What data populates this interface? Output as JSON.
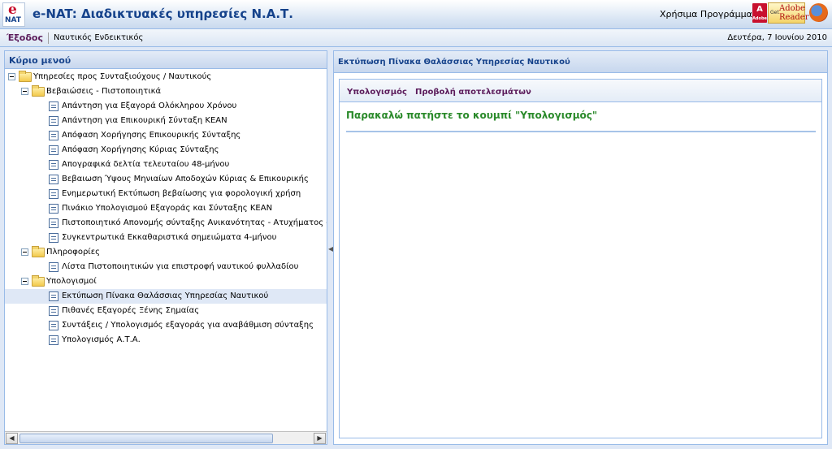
{
  "header": {
    "logo_e": "e",
    "logo_nat": "NAT",
    "title": "e-NAT: Διαδικτυακές υπηρεσίες Ν.Α.Τ.",
    "programs_label": "Χρήσιμα Προγράμματα:",
    "adobe_text": "A",
    "adobe_sub": "Adobe",
    "reader_get": "Get",
    "reader_adobe": "Adobe",
    "reader_reader": "Reader"
  },
  "toolbar": {
    "exit_label": "Έξοδος",
    "user_label": "Ναυτικός Ενδεικτικός",
    "date": "Δευτέρα, 7 Ιουνίου 2010"
  },
  "left_panel": {
    "title": "Κύριο μενού",
    "tree": [
      {
        "label": "Υπηρεσίες προς Συνταξιούχους / Ναυτικούς",
        "type": "folder",
        "level": 0
      },
      {
        "label": "Βεβαιώσεις - Πιστοποιητικά",
        "type": "folder",
        "level": 1
      },
      {
        "label": "Απάντηση για Εξαγορά Ολόκληρου Χρόνου",
        "type": "leaf",
        "level": 2
      },
      {
        "label": "Απάντηση για Επικουρική Σύνταξη ΚΕΑΝ",
        "type": "leaf",
        "level": 2
      },
      {
        "label": "Απόφαση Χορήγησης Επικουρικής Σύνταξης",
        "type": "leaf",
        "level": 2
      },
      {
        "label": "Απόφαση Χορήγησης Κύριας Σύνταξης",
        "type": "leaf",
        "level": 2
      },
      {
        "label": "Απογραφικά δελτία τελευταίου 48-μήνου",
        "type": "leaf",
        "level": 2
      },
      {
        "label": "Βεβαιωση Ύψους Μηνιαίων Αποδοχών Κύριας & Επικουρικής",
        "type": "leaf",
        "level": 2
      },
      {
        "label": "Ενημερωτική Εκτύπωση βεβαίωσης για φορολογική χρήση",
        "type": "leaf",
        "level": 2
      },
      {
        "label": "Πινάκιο Υπολογισμού Εξαγοράς και Σύνταξης ΚΕΑΝ",
        "type": "leaf",
        "level": 2
      },
      {
        "label": "Πιστοποιητικό Απονομής σύνταξης Ανικανότητας - Ατυχήματος - Γήρ",
        "type": "leaf",
        "level": 2
      },
      {
        "label": "Συγκεντρωτικά Εκκαθαριστικά σημειώματα 4-μήνου",
        "type": "leaf",
        "level": 2
      },
      {
        "label": "Πληροφορίες",
        "type": "folder",
        "level": 1
      },
      {
        "label": "Λίστα Πιστοποιητικών για επιστροφή ναυτικού φυλλαδίου",
        "type": "leaf",
        "level": 2
      },
      {
        "label": "Υπολογισμοί",
        "type": "folder",
        "level": 1
      },
      {
        "label": "Εκτύπωση Πίνακα Θαλάσσιας Υπηρεσίας Ναυτικού",
        "type": "leaf",
        "level": 2,
        "selected": true
      },
      {
        "label": "Πιθανές Εξαγορές Ξένης Σημαίας",
        "type": "leaf",
        "level": 2
      },
      {
        "label": "Συντάξεις / Υπολογισμός εξαγοράς για αναβάθμιση σύνταξης",
        "type": "leaf",
        "level": 2
      },
      {
        "label": "Υπολογισμός Α.Τ.Α.",
        "type": "leaf",
        "level": 2
      }
    ]
  },
  "right_panel": {
    "title": "Εκτύπωση Πίνακα Θαλάσσιας Υπηρεσίας Ναυτικού",
    "calc_button": "Υπολογισμός",
    "view_results_button": "Προβολή αποτελεσμάτων",
    "message": "Παρακαλώ πατήστε το κουμπί \"Υπολογισμός\""
  },
  "colors": {
    "header_text": "#15428b",
    "link_purple": "#5a1a5a",
    "message_green": "#2a8a2a",
    "border_blue": "#99bbe8"
  }
}
